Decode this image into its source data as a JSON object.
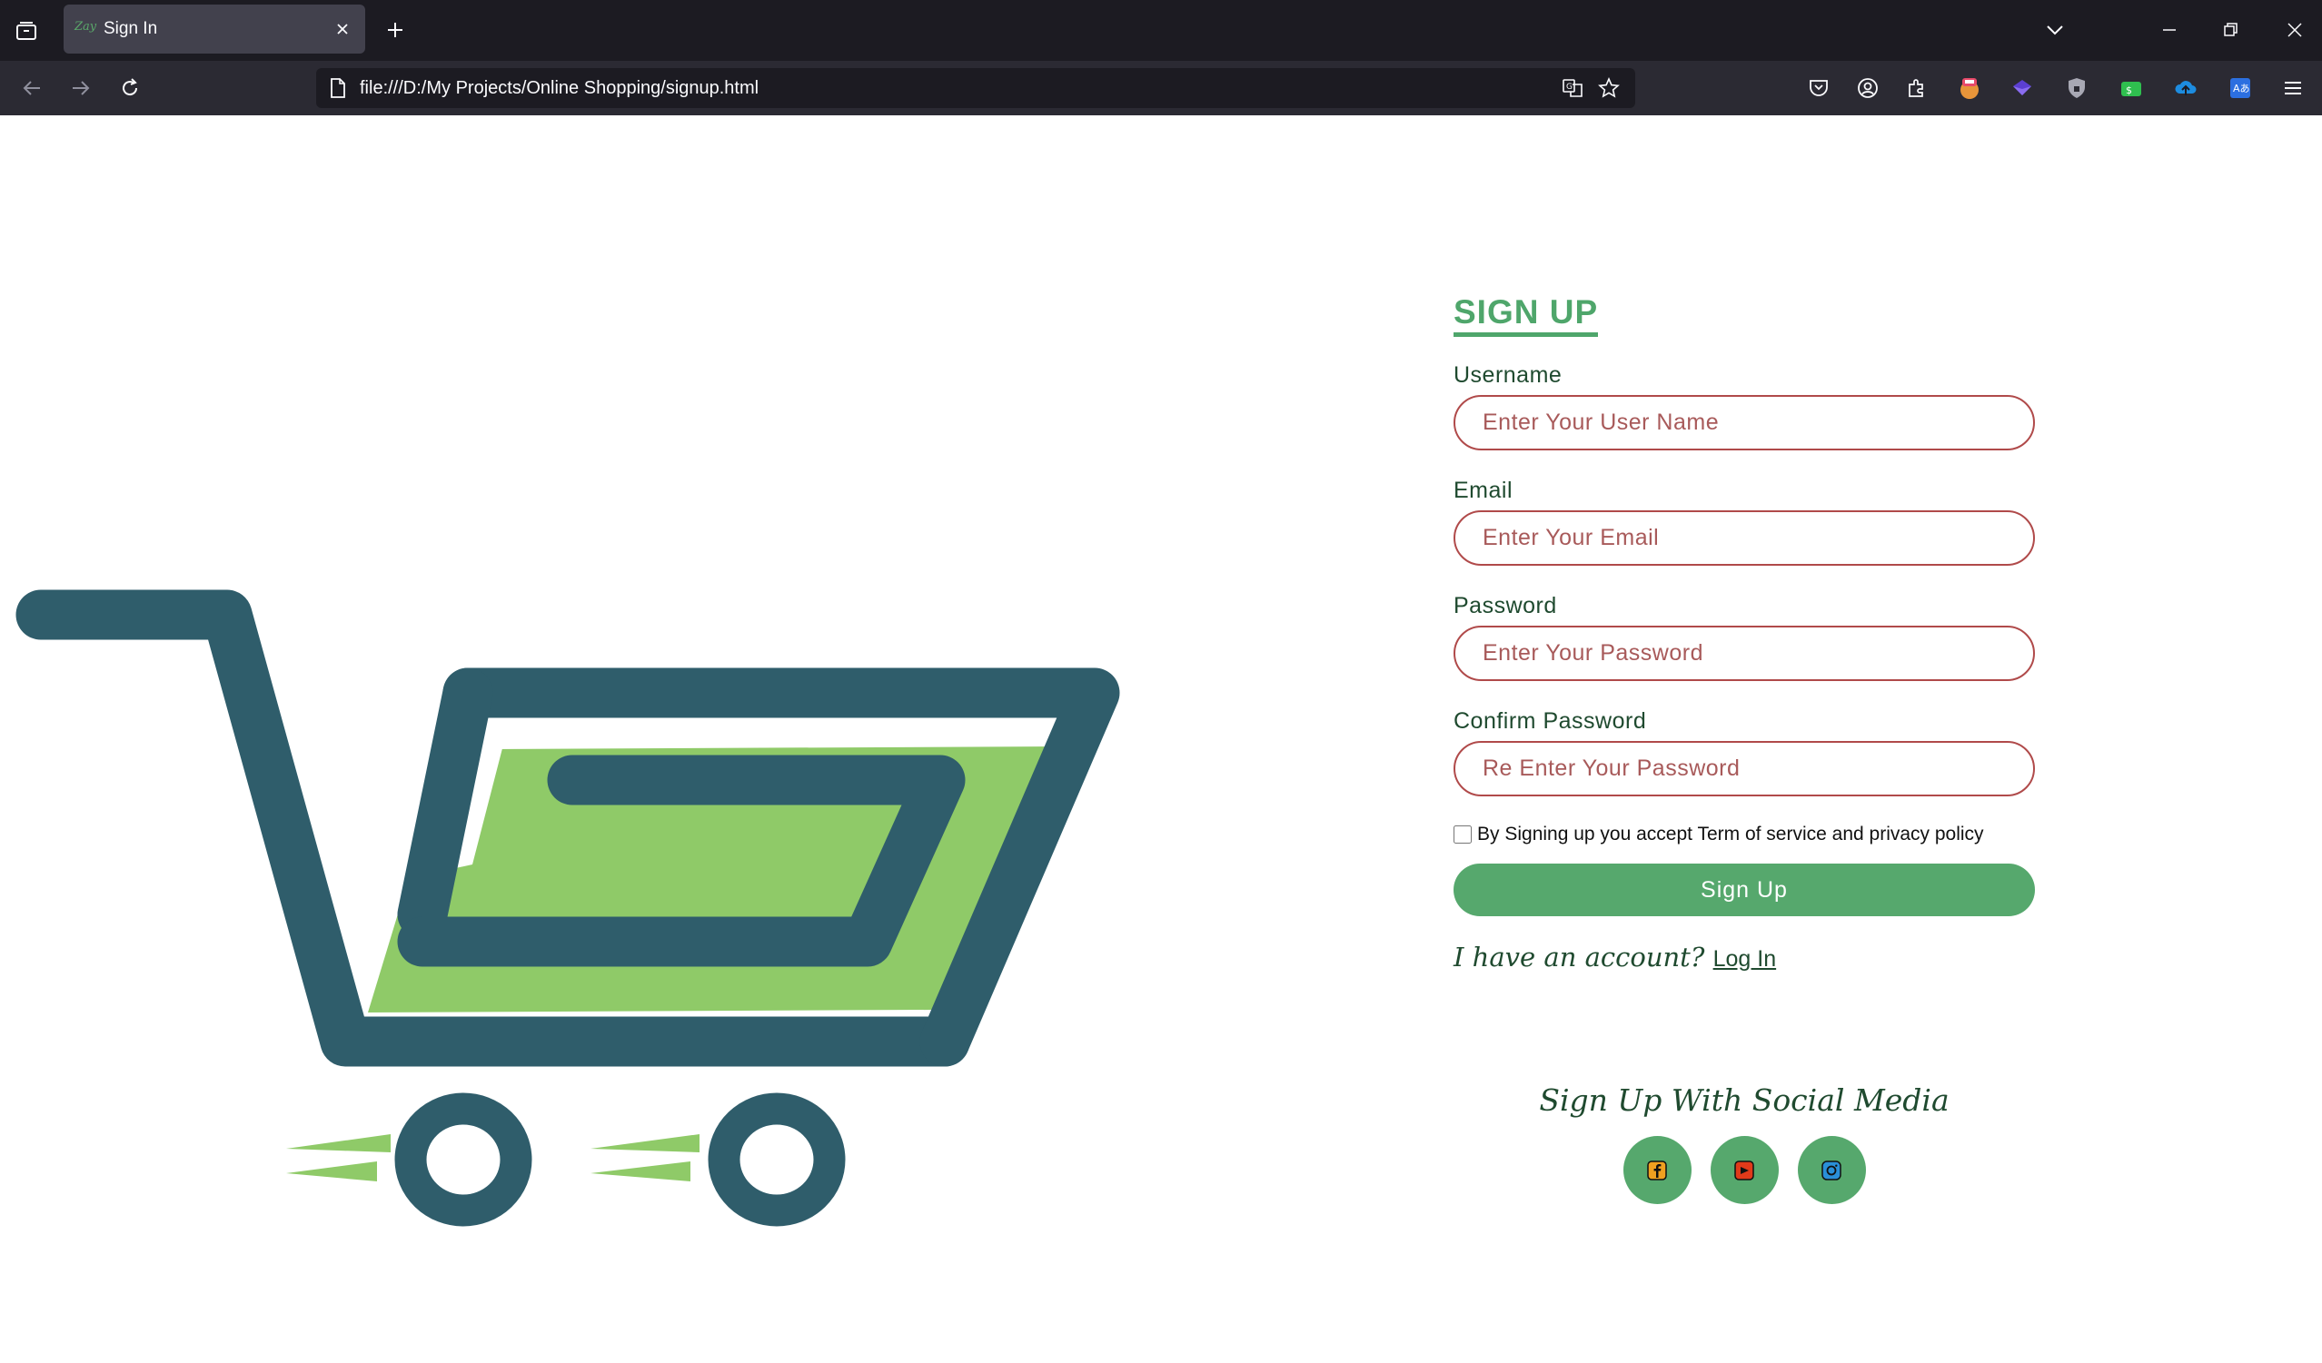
{
  "browser": {
    "tab_title": "Sign In",
    "tab_favicon_text": "Zay",
    "url": "file:///D:/My Projects/Online Shopping/signup.html"
  },
  "colors": {
    "accent": "#4fa66b",
    "input_border": "#b04a4a",
    "text_dark": "#1f4a2f",
    "cart_dark": "#2f5d6b",
    "cart_light": "#8fca68"
  },
  "form": {
    "title": "SIGN UP",
    "fields": [
      {
        "label": "Username",
        "placeholder": "Enter Your User Name",
        "value": ""
      },
      {
        "label": "Email",
        "placeholder": "Enter Your Email",
        "value": ""
      },
      {
        "label": "Password",
        "placeholder": "Enter Your Password",
        "value": ""
      },
      {
        "label": "Confirm Password",
        "placeholder": "Re Enter Your Password",
        "value": ""
      }
    ],
    "terms_text": "By Signing up you accept Term of service and privacy policy",
    "terms_checked": false,
    "submit_label": "Sign Up",
    "account_text": "I have an account?",
    "login_link": "Log In"
  },
  "social": {
    "title": "Sign Up With Social Media",
    "icons": [
      "facebook-icon",
      "youtube-icon",
      "instagram-icon"
    ]
  }
}
